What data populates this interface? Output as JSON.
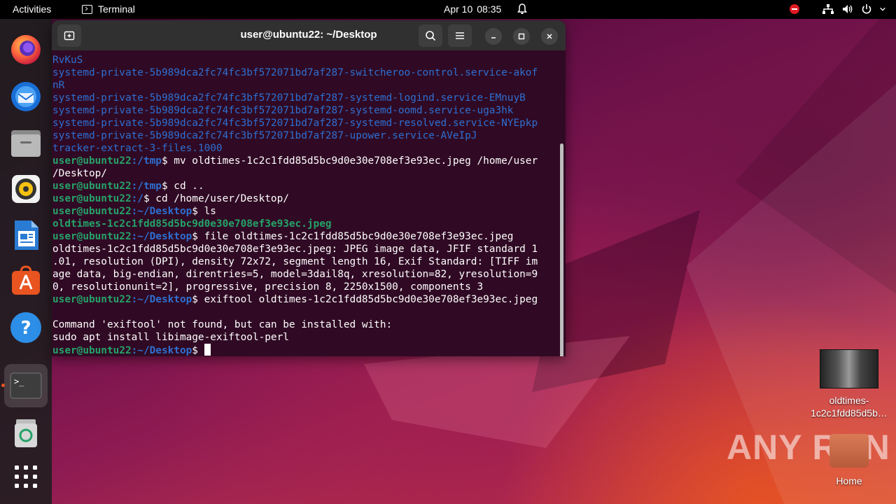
{
  "topbar": {
    "activities": "Activities",
    "app_name": "Terminal",
    "date": "Apr 10",
    "time": "08:35"
  },
  "dock": {
    "items": [
      {
        "name": "firefox",
        "icon": "firefox-icon"
      },
      {
        "name": "thunderbird",
        "icon": "thunderbird-icon"
      },
      {
        "name": "files",
        "icon": "files-icon"
      },
      {
        "name": "rhythmbox",
        "icon": "rhythmbox-icon"
      },
      {
        "name": "libreoffice-writer",
        "icon": "writer-icon"
      },
      {
        "name": "ubuntu-software",
        "icon": "software-icon"
      },
      {
        "name": "help",
        "icon": "help-icon"
      },
      {
        "name": "terminal",
        "icon": "terminal-icon"
      },
      {
        "name": "trash",
        "icon": "trash-icon"
      },
      {
        "name": "show-apps",
        "icon": "app-grid-icon"
      }
    ]
  },
  "terminal": {
    "title": "user@ubuntu22: ~/Desktop",
    "prompt_user": "user@ubuntu22",
    "lines": {
      "l1": "RvKuS",
      "l2": "systemd-private-5b989dca2fc74fc3bf572071bd7af287-switcheroo-control.service-akof",
      "l3": "nR",
      "l4": "systemd-private-5b989dca2fc74fc3bf572071bd7af287-systemd-logind.service-EMnuyB",
      "l5": "systemd-private-5b989dca2fc74fc3bf572071bd7af287-systemd-oomd.service-uga3hk",
      "l6": "systemd-private-5b989dca2fc74fc3bf572071bd7af287-systemd-resolved.service-NYEpkp",
      "l7": "systemd-private-5b989dca2fc74fc3bf572071bd7af287-upower.service-AVeIpJ",
      "l8": "tracker-extract-3-files.1000",
      "l9_path": ":/tmp",
      "l9_cmd": "$ mv oldtimes-1c2c1fdd85d5bc9d0e30e708ef3e93ec.jpeg /home/user",
      "l10": "/Desktop/",
      "l11_path": ":/tmp",
      "l11_cmd": "$ cd ..",
      "l12_path": ":/",
      "l12_cmd": "$ cd /home/user/Desktop/",
      "l13_path": ":~/Desktop",
      "l13_cmd": "$ ls",
      "l14": "oldtimes-1c2c1fdd85d5bc9d0e30e708ef3e93ec.jpeg",
      "l15_path": ":~/Desktop",
      "l15_cmd": "$ file oldtimes-1c2c1fdd85d5bc9d0e30e708ef3e93ec.jpeg",
      "l16": "oldtimes-1c2c1fdd85d5bc9d0e30e708ef3e93ec.jpeg: JPEG image data, JFIF standard 1",
      "l17": ".01, resolution (DPI), density 72x72, segment length 16, Exif Standard: [TIFF im",
      "l18": "age data, big-endian, direntries=5, model=3dail8q, xresolution=82, yresolution=9",
      "l19": "0, resolutionunit=2], progressive, precision 8, 2250x1500, components 3",
      "l20_path": ":~/Desktop",
      "l20_cmd": "$ exiftool oldtimes-1c2c1fdd85d5bc9d0e30e708ef3e93ec.jpeg",
      "l21": "",
      "l22": "Command 'exiftool' not found, but can be installed with:",
      "l23": "sudo apt install libimage-exiftool-perl",
      "l24_path": ":~/Desktop",
      "l24_cmd": "$ "
    }
  },
  "desktop": {
    "file_label_1": "oldtimes-",
    "file_label_2": "1c2c1fdd85d5b…",
    "home_label": "Home"
  },
  "watermark": "ANY RUN"
}
